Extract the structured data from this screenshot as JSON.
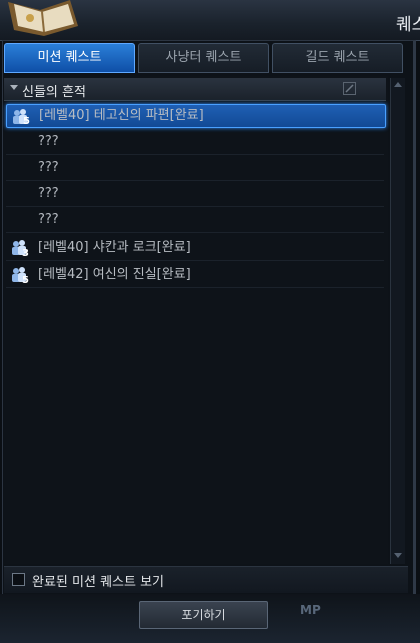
{
  "window": {
    "title": "퀘스"
  },
  "tabs": [
    {
      "label": "미션 퀘스트",
      "active": true
    },
    {
      "label": "사냥터 퀘스트",
      "active": false
    },
    {
      "label": "길드 퀘스트",
      "active": false
    }
  ],
  "group": {
    "title": "신들의 흔적",
    "expanded": true
  },
  "rows": [
    {
      "party": "5",
      "label": "[레벨40] 테고신의 파편[완료]",
      "selected": true
    },
    {
      "party": null,
      "label": "???"
    },
    {
      "party": null,
      "label": "???"
    },
    {
      "party": null,
      "label": "???"
    },
    {
      "party": null,
      "label": "???"
    },
    {
      "party": "3",
      "label": "[레벨40] 샤칸과 로크[완료]"
    },
    {
      "party": "5",
      "label": "[레벨42] 여신의 진실[완료]"
    }
  ],
  "show_completed": {
    "label": "완료된 미션 퀘스트 보기",
    "checked": false
  },
  "footer": {
    "giveup_label": "포기하기",
    "mp_label": "MP"
  },
  "colors": {
    "accent": "#1f5fb4",
    "tab_active": "#2b7fd8",
    "background": "#0b0f14"
  }
}
